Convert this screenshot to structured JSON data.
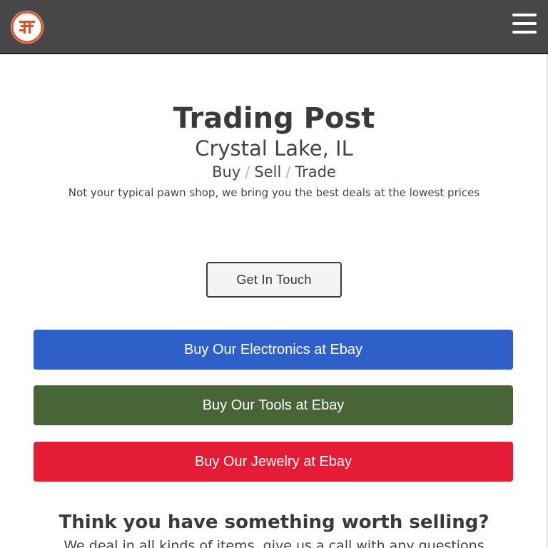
{
  "header": {
    "logo_icon": "trading-post-logo-icon",
    "menu_icon": "hamburger-menu-icon",
    "background_color": "#474747",
    "logo_color": "#e2502a"
  },
  "hero": {
    "title": "Trading Post",
    "location": "Crystal Lake, IL",
    "tagline": {
      "buy": "Buy",
      "separator": "/",
      "sell": "Sell",
      "trade": "Trade"
    },
    "description": "Not your typical pawn shop, we bring you the best deals at the lowest prices"
  },
  "contact_button": {
    "label": "Get In Touch"
  },
  "ebay_buttons": [
    {
      "label": "Buy Our Electronics at Ebay",
      "color": "#2f5fc8"
    },
    {
      "label": "Buy Our Tools at Ebay",
      "color": "#476537"
    },
    {
      "label": "Buy Our Jewelry at Ebay",
      "color": "#e51c35"
    }
  ],
  "sell_section": {
    "heading": "Think you have something worth selling?",
    "text": "We deal in all kinds of items, give us a call with any questions"
  }
}
